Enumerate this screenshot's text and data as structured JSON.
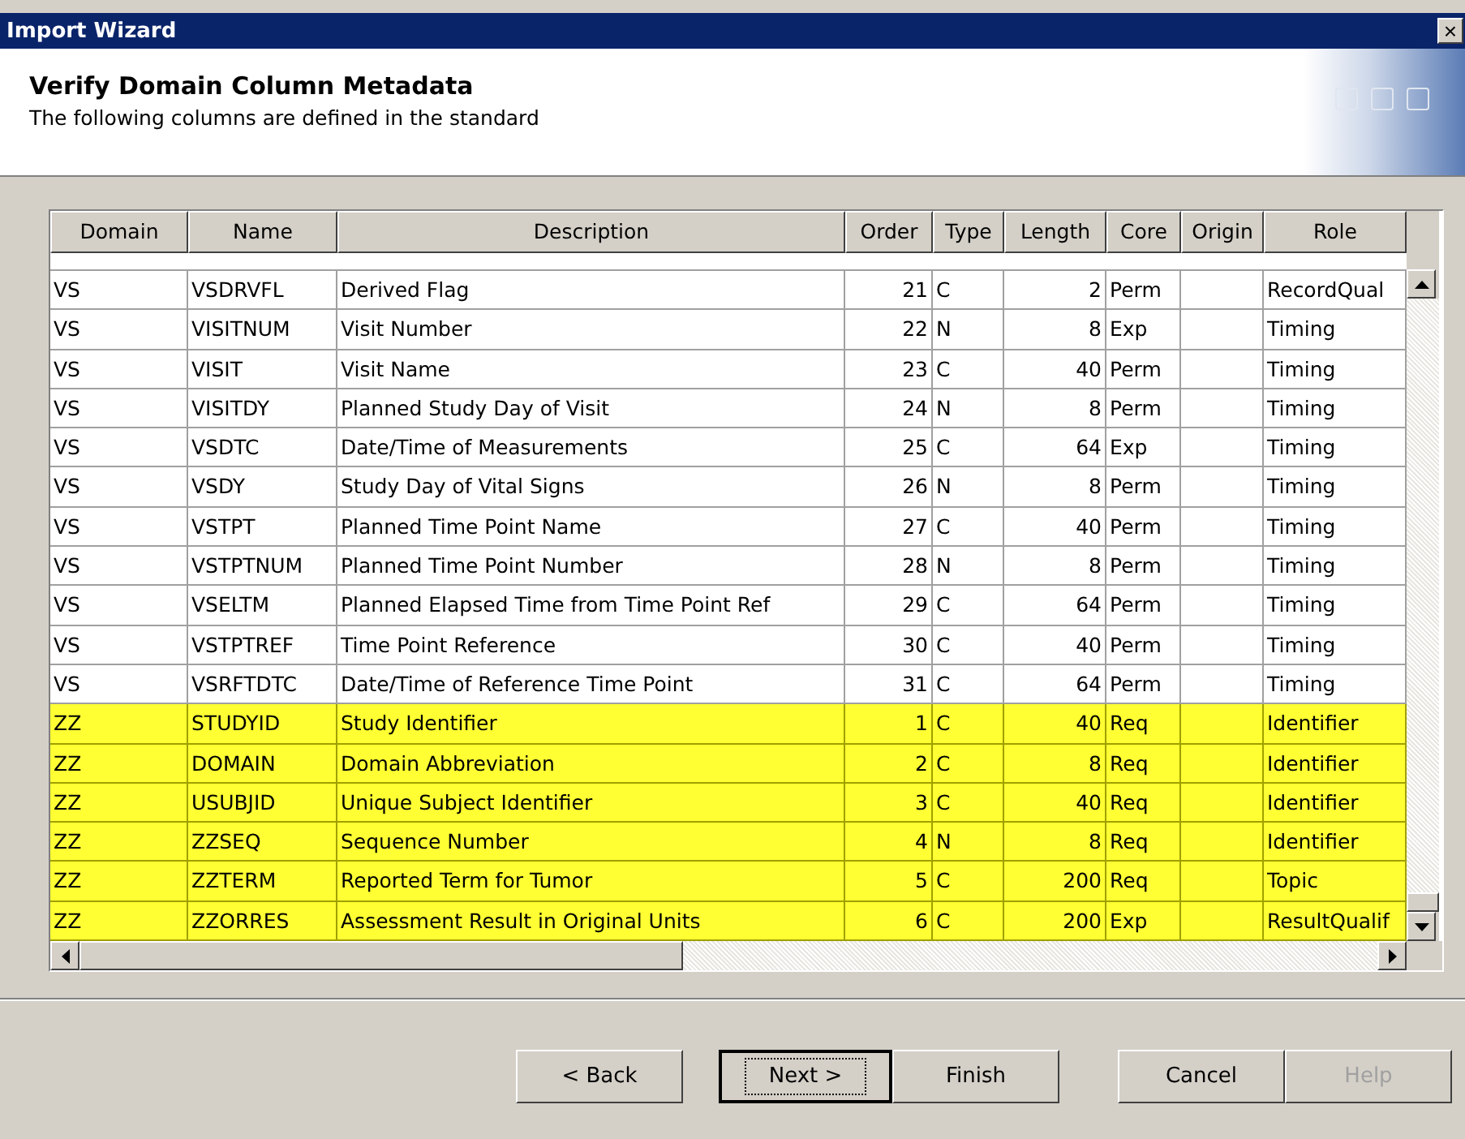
{
  "window": {
    "title": "Import Wizard",
    "close": "×"
  },
  "header": {
    "title": "Verify Domain Column Metadata",
    "subtitle": "The following columns are defined in the standard"
  },
  "table": {
    "columns": [
      "Domain",
      "Name",
      "Description",
      "Order",
      "Type",
      "Length",
      "Core",
      "Origin",
      "Role"
    ],
    "rows": [
      {
        "cells": [
          "VS",
          "VSDRVFL",
          "Derived Flag",
          "21",
          "C",
          "2",
          "Perm",
          "",
          "RecordQual"
        ],
        "highlighted": false
      },
      {
        "cells": [
          "VS",
          "VISITNUM",
          "Visit Number",
          "22",
          "N",
          "8",
          "Exp",
          "",
          "Timing"
        ],
        "highlighted": false
      },
      {
        "cells": [
          "VS",
          "VISIT",
          "Visit Name",
          "23",
          "C",
          "40",
          "Perm",
          "",
          "Timing"
        ],
        "highlighted": false
      },
      {
        "cells": [
          "VS",
          "VISITDY",
          "Planned Study Day of Visit",
          "24",
          "N",
          "8",
          "Perm",
          "",
          "Timing"
        ],
        "highlighted": false
      },
      {
        "cells": [
          "VS",
          "VSDTC",
          "Date/Time of Measurements",
          "25",
          "C",
          "64",
          "Exp",
          "",
          "Timing"
        ],
        "highlighted": false
      },
      {
        "cells": [
          "VS",
          "VSDY",
          "Study Day of Vital Signs",
          "26",
          "N",
          "8",
          "Perm",
          "",
          "Timing"
        ],
        "highlighted": false
      },
      {
        "cells": [
          "VS",
          "VSTPT",
          "Planned Time Point Name",
          "27",
          "C",
          "40",
          "Perm",
          "",
          "Timing"
        ],
        "highlighted": false
      },
      {
        "cells": [
          "VS",
          "VSTPTNUM",
          "Planned Time Point Number",
          "28",
          "N",
          "8",
          "Perm",
          "",
          "Timing"
        ],
        "highlighted": false
      },
      {
        "cells": [
          "VS",
          "VSELTM",
          "Planned Elapsed Time from Time Point Ref",
          "29",
          "C",
          "64",
          "Perm",
          "",
          "Timing"
        ],
        "highlighted": false
      },
      {
        "cells": [
          "VS",
          "VSTPTREF",
          "Time Point Reference",
          "30",
          "C",
          "40",
          "Perm",
          "",
          "Timing"
        ],
        "highlighted": false
      },
      {
        "cells": [
          "VS",
          "VSRFTDTC",
          "Date/Time of Reference Time Point",
          "31",
          "C",
          "64",
          "Perm",
          "",
          "Timing"
        ],
        "highlighted": false
      },
      {
        "cells": [
          "ZZ",
          "STUDYID",
          "Study Identifier",
          "1",
          "C",
          "40",
          "Req",
          "",
          "Identifier"
        ],
        "highlighted": true
      },
      {
        "cells": [
          "ZZ",
          "DOMAIN",
          "Domain Abbreviation",
          "2",
          "C",
          "8",
          "Req",
          "",
          "Identifier"
        ],
        "highlighted": true
      },
      {
        "cells": [
          "ZZ",
          "USUBJID",
          "Unique Subject Identifier",
          "3",
          "C",
          "40",
          "Req",
          "",
          "Identifier"
        ],
        "highlighted": true
      },
      {
        "cells": [
          "ZZ",
          "ZZSEQ",
          "Sequence Number",
          "4",
          "N",
          "8",
          "Req",
          "",
          "Identifier"
        ],
        "highlighted": true
      },
      {
        "cells": [
          "ZZ",
          "ZZTERM",
          "Reported Term for Tumor",
          "5",
          "C",
          "200",
          "Req",
          "",
          "Topic"
        ],
        "highlighted": true
      },
      {
        "cells": [
          "ZZ",
          "ZZORRES",
          "Assessment Result in Original Units",
          "6",
          "C",
          "200",
          "Exp",
          "",
          "ResultQualif"
        ],
        "highlighted": true
      }
    ]
  },
  "buttons": [
    {
      "label": "< Back",
      "default": false,
      "disabled": false
    },
    {
      "label": "Next >",
      "default": true,
      "disabled": false
    },
    {
      "label": "Finish",
      "default": false,
      "disabled": false
    },
    {
      "label": "Cancel",
      "default": false,
      "disabled": false
    },
    {
      "label": "Help",
      "default": false,
      "disabled": true
    }
  ]
}
